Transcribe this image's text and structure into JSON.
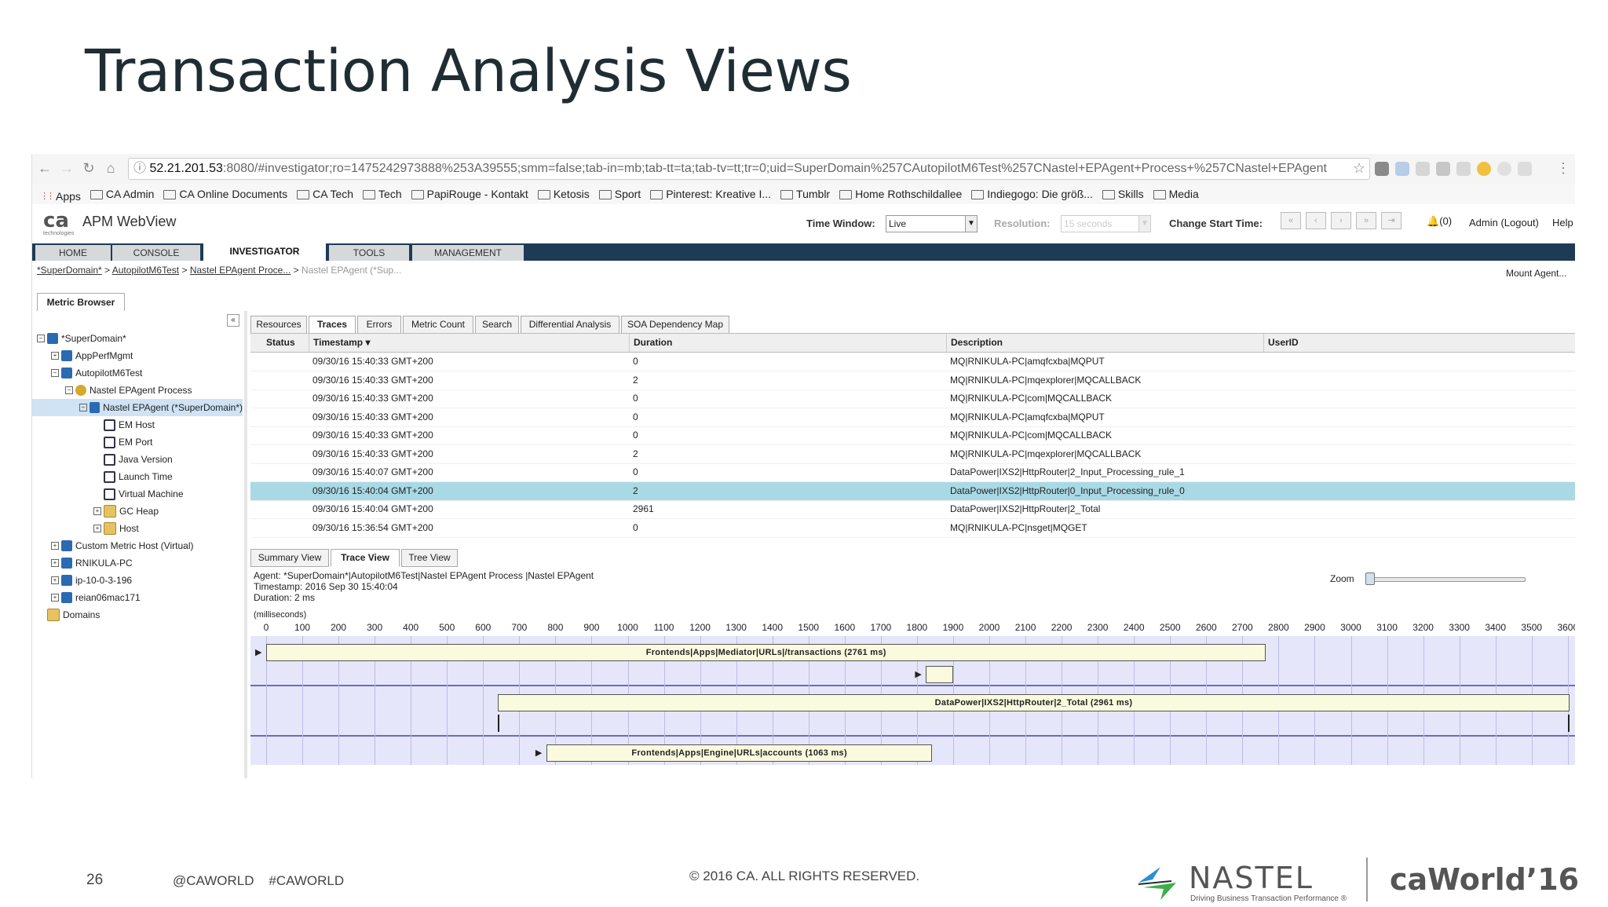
{
  "slide": {
    "title": "Transaction Analysis Views",
    "page_number": "26",
    "hashtags": "@CAWORLD    #CAWORLD",
    "copyright": "© 2016 CA. ALL RIGHTS RESERVED.",
    "nastel_name": "NASTEL",
    "nastel_tagline": "Driving Business Transaction Performance ®",
    "caworld_logo": "World’16",
    "caworld_ca": "ca"
  },
  "browser": {
    "url_host": "52.21.201.53",
    "url_rest": ":8080/#investigator;ro=1475242973888%253A39555;smm=false;tab-in=mb;tab-tt=ta;tab-tv=tt;tr=0;uid=SuperDomain%257CAutopilotM6Test%257CNastel+EPAgent+Process+%257CNastel+EPAgent",
    "bookmarks": [
      "Apps",
      "CA Admin",
      "CA Online Documents",
      "CA Tech",
      "Tech",
      "PapiRouge - Kontakt",
      "Ketosis",
      "Sport",
      "Pinterest: Kreative I...",
      "Tumblr",
      "Home Rothschildallee",
      "Indiegogo: Die größ...",
      "Skills",
      "Media"
    ]
  },
  "app": {
    "logo": "ca",
    "logo_sub": "technologies",
    "name": "APM WebView",
    "time_window_label": "Time Window:",
    "time_window_value": "Live",
    "resolution_label": "Resolution:",
    "resolution_value": "15 seconds",
    "change_start_label": "Change Start Time:",
    "alerts": "(0)",
    "user": "Admin (Logout)",
    "help": "Help",
    "nav_tabs": [
      "HOME",
      "CONSOLE",
      "INVESTIGATOR",
      "TOOLS",
      "MANAGEMENT"
    ],
    "breadcrumb": [
      "*SuperDomain*",
      "AutopilotM6Test",
      "Nastel EPAgent Proce...",
      "Nastel EPAgent (*Sup..."
    ],
    "mount_agent": "Mount Agent...",
    "metric_browser_tab": "Metric Browser",
    "collapse_icon": "«"
  },
  "tree": [
    {
      "label": "*SuperDomain*",
      "depth": 0,
      "exp": "−",
      "icon": "domain"
    },
    {
      "label": "AppPerfMgmt",
      "depth": 1,
      "exp": "+",
      "icon": "cube"
    },
    {
      "label": "AutopilotM6Test",
      "depth": 1,
      "exp": "−",
      "icon": "cube"
    },
    {
      "label": "Nastel EPAgent Process",
      "depth": 2,
      "exp": "−",
      "icon": "proc"
    },
    {
      "label": "Nastel EPAgent (*SuperDomain*)",
      "depth": 3,
      "exp": "−",
      "icon": "cube",
      "selected": true
    },
    {
      "label": "EM Host",
      "depth": 4,
      "exp": "",
      "icon": "mon"
    },
    {
      "label": "EM Port",
      "depth": 4,
      "exp": "",
      "icon": "mon"
    },
    {
      "label": "Java Version",
      "depth": 4,
      "exp": "",
      "icon": "mon"
    },
    {
      "label": "Launch Time",
      "depth": 4,
      "exp": "",
      "icon": "mon"
    },
    {
      "label": "Virtual Machine",
      "depth": 4,
      "exp": "",
      "icon": "mon"
    },
    {
      "label": "GC Heap",
      "depth": 4,
      "exp": "+",
      "icon": "fold"
    },
    {
      "label": "Host",
      "depth": 4,
      "exp": "+",
      "icon": "fold"
    },
    {
      "label": "Custom Metric Host (Virtual)",
      "depth": 1,
      "exp": "+",
      "icon": "cube"
    },
    {
      "label": "RNIKULA-PC",
      "depth": 1,
      "exp": "+",
      "icon": "cube"
    },
    {
      "label": "ip-10-0-3-196",
      "depth": 1,
      "exp": "+",
      "icon": "cube"
    },
    {
      "label": "reian06mac171",
      "depth": 1,
      "exp": "+",
      "icon": "cube"
    },
    {
      "label": "Domains",
      "depth": 0,
      "exp": "",
      "icon": "fold"
    }
  ],
  "trace_tabs": [
    "Resources",
    "Traces",
    "Errors",
    "Metric Count",
    "Search",
    "Differential Analysis",
    "SOA Dependency Map"
  ],
  "grid": {
    "headers": [
      "Status",
      "Timestamp ▾",
      "Duration",
      "Description",
      "UserID"
    ],
    "rows": [
      {
        "ts": "09/30/16 15:40:33 GMT+200",
        "dur": "0",
        "desc": "MQ|RNIKULA-PC|amqfcxba|MQPUT"
      },
      {
        "ts": "09/30/16 15:40:33 GMT+200",
        "dur": "2",
        "desc": "MQ|RNIKULA-PC|mqexplorer|MQCALLBACK"
      },
      {
        "ts": "09/30/16 15:40:33 GMT+200",
        "dur": "0",
        "desc": "MQ|RNIKULA-PC|com|MQCALLBACK"
      },
      {
        "ts": "09/30/16 15:40:33 GMT+200",
        "dur": "0",
        "desc": "MQ|RNIKULA-PC|amqfcxba|MQPUT"
      },
      {
        "ts": "09/30/16 15:40:33 GMT+200",
        "dur": "0",
        "desc": "MQ|RNIKULA-PC|com|MQCALLBACK"
      },
      {
        "ts": "09/30/16 15:40:33 GMT+200",
        "dur": "2",
        "desc": "MQ|RNIKULA-PC|mqexplorer|MQCALLBACK"
      },
      {
        "ts": "09/30/16 15:40:07 GMT+200",
        "dur": "0",
        "desc": "DataPower|IXS2|HttpRouter|2_Input_Processing_rule_1"
      },
      {
        "ts": "09/30/16 15:40:04 GMT+200",
        "dur": "2",
        "desc": "DataPower|IXS2|HttpRouter|0_Input_Processing_rule_0",
        "selected": true
      },
      {
        "ts": "09/30/16 15:40:04 GMT+200",
        "dur": "2961",
        "desc": "DataPower|IXS2|HttpRouter|2_Total"
      },
      {
        "ts": "09/30/16 15:36:54 GMT+200",
        "dur": "0",
        "desc": "MQ|RNIKULA-PC|nsget|MQGET"
      }
    ]
  },
  "view_tabs": [
    "Summary View",
    "Trace View",
    "Tree View"
  ],
  "trace_info": {
    "agent": "Agent: *SuperDomain*|AutopilotM6Test|Nastel EPAgent Process |Nastel EPAgent",
    "timestamp": "Timestamp: 2016 Sep 30 15:40:04",
    "duration": "Duration: 2 ms",
    "zoom_label": "Zoom",
    "ms_label": "(milliseconds)"
  },
  "timeline": {
    "ticks": [
      0,
      100,
      200,
      300,
      400,
      500,
      600,
      700,
      800,
      900,
      1000,
      1100,
      1200,
      1300,
      1400,
      1500,
      1600,
      1700,
      1800,
      1900,
      2000,
      2100,
      2200,
      2300,
      2400,
      2500,
      2600,
      2700,
      2800,
      2900,
      3000,
      3100,
      3200,
      3300,
      3400,
      3500,
      3600
    ],
    "spans": [
      {
        "label": "Frontends|Apps|Mediator|URLs|/transactions (2761 ms)",
        "start": 0,
        "duration": 2761,
        "lane": 0,
        "row": 0
      },
      {
        "label": "",
        "start": 1825,
        "duration": 70,
        "lane": 0,
        "row": 1
      },
      {
        "label": "DataPower|IXS2|HttpRouter|2_Total (2961 ms)",
        "start": 640,
        "duration": 2961,
        "lane": 1,
        "row": 0
      },
      {
        "label": "Frontends|Apps|Engine|URLs|accounts (1063 ms)",
        "start": 775,
        "duration": 1063,
        "lane": 2,
        "row": 0
      }
    ]
  }
}
